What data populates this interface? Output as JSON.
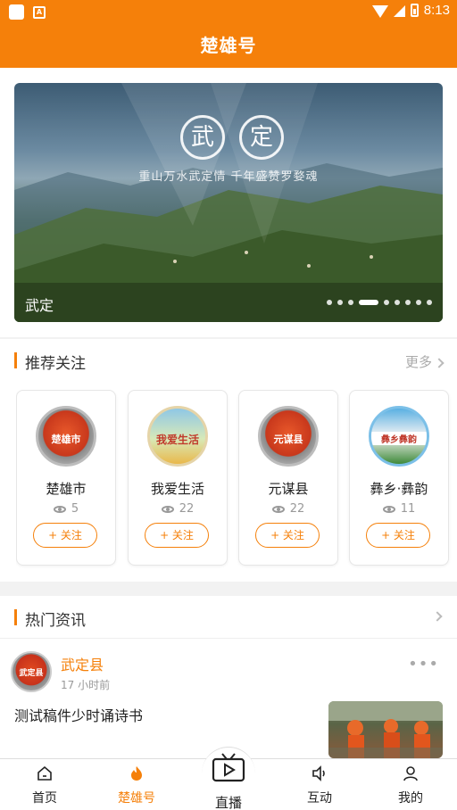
{
  "status_bar": {
    "time": "8:13",
    "icons": [
      "app-square-icon",
      "a-badge-icon",
      "wifi-icon",
      "signal-icon",
      "battery-icon"
    ]
  },
  "header": {
    "title": "楚雄号"
  },
  "banner": {
    "seal_chars": [
      "武",
      "定"
    ],
    "subtitle": "重山万水武定情 千年盛赞罗婺魂",
    "caption": "武定",
    "dot_count": 9,
    "active_dot": 3
  },
  "recommended": {
    "title": "推荐关注",
    "more": "更多",
    "items": [
      {
        "name": "楚雄市",
        "views": "5",
        "avatar_label": "楚雄市",
        "follow": "+ 关注"
      },
      {
        "name": "我爱生活",
        "views": "22",
        "avatar_label": "我爱生活",
        "follow": "+ 关注"
      },
      {
        "name": "元谋县",
        "views": "22",
        "avatar_label": "元谋县",
        "follow": "+ 关注"
      },
      {
        "name": "彝乡·彝韵",
        "views": "11",
        "avatar_label": "彝乡彝韵",
        "follow": "+ 关注"
      }
    ]
  },
  "hot_news": {
    "title": "热门资讯",
    "items": [
      {
        "source": "武定县",
        "avatar_label": "武定县",
        "time": "17  小时前",
        "title": "测试稿件少时诵诗书"
      }
    ]
  },
  "tabbar": {
    "items": [
      {
        "label": "首页",
        "icon": "home-icon"
      },
      {
        "label": "楚雄号",
        "icon": "flame-icon"
      },
      {
        "label": "直播",
        "icon": "live-tv-icon"
      },
      {
        "label": "互动",
        "icon": "speaker-icon"
      },
      {
        "label": "我的",
        "icon": "user-icon"
      }
    ]
  },
  "colors": {
    "accent": "#f5800a",
    "background": "#f2f2f2"
  }
}
